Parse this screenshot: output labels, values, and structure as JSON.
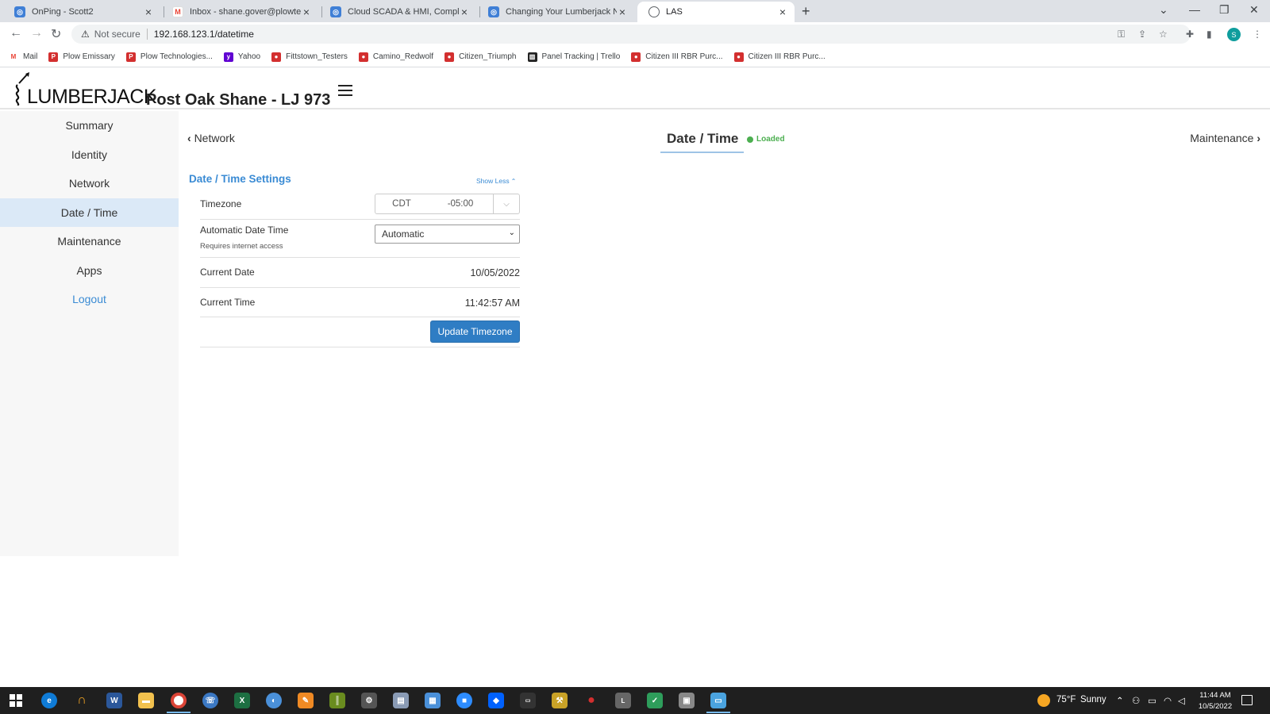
{
  "browser": {
    "tabs": [
      {
        "title": "OnPing - Scott2",
        "icon": "onping-icon",
        "color": "#3f7fd6"
      },
      {
        "title": "Inbox - shane.gover@plowtech.n",
        "icon": "gmail-icon",
        "color": "#ea4335"
      },
      {
        "title": "Cloud SCADA & HMI, Completely",
        "icon": "onping-icon",
        "color": "#3f7fd6"
      },
      {
        "title": "Changing Your Lumberjack Netw",
        "icon": "onping-icon",
        "color": "#3f7fd6"
      },
      {
        "title": "LAS",
        "icon": "globe-icon",
        "color": "#5f6368"
      }
    ],
    "security_label": "Not secure",
    "url": "192.168.123.1/datetime",
    "profile_initial": "S",
    "bookmarks": [
      {
        "label": "Mail",
        "icon": "gmail-icon",
        "color": "#ea4335"
      },
      {
        "label": "Plow Emissary",
        "icon": "plow-icon",
        "color": "#d32f2f"
      },
      {
        "label": "Plow Technologies...",
        "icon": "plow-icon",
        "color": "#d32f2f"
      },
      {
        "label": "Yahoo",
        "icon": "yahoo-icon",
        "color": "#6001d2"
      },
      {
        "label": "Fittstown_Testers",
        "icon": "map-pin-icon",
        "color": "#d32f2f"
      },
      {
        "label": "Camino_Redwolf",
        "icon": "map-pin-icon",
        "color": "#d32f2f"
      },
      {
        "label": "Citizen_Triumph",
        "icon": "map-pin-icon",
        "color": "#d32f2f"
      },
      {
        "label": "Panel Tracking | Trello",
        "icon": "trello-icon",
        "color": "#222222"
      },
      {
        "label": "Citizen III RBR Purc...",
        "icon": "map-pin-icon",
        "color": "#d32f2f"
      },
      {
        "label": "Citizen III RBR Purc...",
        "icon": "map-pin-icon",
        "color": "#d32f2f"
      }
    ]
  },
  "header": {
    "logo_text": "LUMBERJACK",
    "site_title": "Post Oak Shane - LJ 973"
  },
  "sidebar": {
    "items": [
      {
        "label": "Summary"
      },
      {
        "label": "Identity"
      },
      {
        "label": "Network"
      },
      {
        "label": "Date / Time",
        "active": true
      },
      {
        "label": "Maintenance"
      },
      {
        "label": "Apps"
      },
      {
        "label": "Logout"
      }
    ]
  },
  "main": {
    "prev_label": "Network",
    "next_label": "Maintenance",
    "page_title": "Date / Time",
    "status": "Loaded",
    "status_color": "#4caf50",
    "section_title": "Date / Time Settings",
    "toggle_label": "Show Less",
    "timezone": {
      "label": "Timezone",
      "abbr": "CDT",
      "offset": "-05:00"
    },
    "auto_datetime": {
      "label": "Automatic Date Time",
      "hint": "Requires internet access",
      "value": "Automatic"
    },
    "current_date": {
      "label": "Current Date",
      "value": "10/05/2022"
    },
    "current_time": {
      "label": "Current Time",
      "value": "11:42:57 AM"
    },
    "update_button": "Update Timezone",
    "accent_color": "#3a8bd4"
  },
  "taskbar": {
    "weather": "75°F",
    "weather_desc": "Sunny",
    "time": "11:44 AM",
    "date": "10/5/2022"
  }
}
